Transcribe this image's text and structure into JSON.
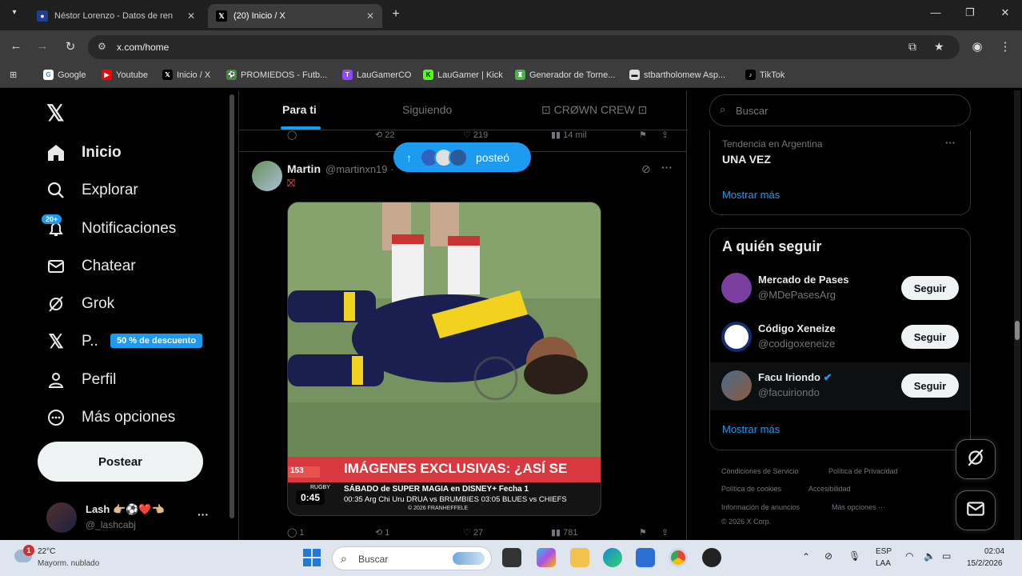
{
  "browser": {
    "tabs": [
      {
        "title": "Néstor Lorenzo - Datos de ren",
        "favicon": "afa-icon"
      },
      {
        "title": "(20) Inicio / X",
        "favicon": "x-icon"
      }
    ],
    "url": "x.com/home",
    "bookmarks": [
      {
        "label": "Google",
        "icon": "google-icon",
        "color": "#4285f4"
      },
      {
        "label": "Youtube",
        "icon": "youtube-icon",
        "color": "#ff0000"
      },
      {
        "label": "Inicio / X",
        "icon": "x-icon",
        "color": "#000000"
      },
      {
        "label": "PROMIEDOS - Futb...",
        "icon": "promiedos-icon",
        "color": "#3a8f3a"
      },
      {
        "label": "LauGamerCO",
        "icon": "twitch-icon",
        "color": "#9146ff"
      },
      {
        "label": "LauGamer | Kick",
        "icon": "kick-icon",
        "color": "#53fc18"
      },
      {
        "label": "Generador de Torne...",
        "icon": "trophy-icon",
        "color": "#4caf50"
      },
      {
        "label": "stbartholomew Asp...",
        "icon": "bookmark-icon",
        "color": "#ffffff"
      },
      {
        "label": "TikTok",
        "icon": "tiktok-icon",
        "color": "#000000"
      }
    ]
  },
  "nav": {
    "items": [
      {
        "label": "Inicio",
        "icon": "home-icon",
        "active": true
      },
      {
        "label": "Explorar",
        "icon": "search-icon"
      },
      {
        "label": "Notificaciones",
        "icon": "bell-icon"
      },
      {
        "label": "Chatear",
        "icon": "mail-icon"
      },
      {
        "label": "Grok",
        "icon": "grok-icon"
      },
      {
        "label": "P..",
        "icon": "x-premium-icon"
      },
      {
        "label": "Perfil",
        "icon": "person-icon"
      },
      {
        "label": "Más opciones",
        "icon": "more-circle-icon"
      }
    ],
    "notif_badge": "20+",
    "promo_badge": "50 % de descuento",
    "post_button": "Postear",
    "account": {
      "name": "Lash 👉🏼⚽❤️👈🏼",
      "handle": "@_lashcabj",
      "more": "···"
    }
  },
  "feed": {
    "tabs": [
      {
        "label": "Para ti",
        "active": true
      },
      {
        "label": "Siguiendo"
      },
      {
        "label": "⊡ CRØWN CREW ⊡"
      }
    ],
    "prev_actions": {
      "replies": "",
      "reposts": "22",
      "likes": "219",
      "views": "14 mil"
    },
    "posted_pill": "posteó",
    "tweet": {
      "name": "Martin",
      "handle": "@martinxn19 ·",
      "media": {
        "banner": "IMÁGENES EXCLUSIVAS: ¿ASÍ SE",
        "score": "153",
        "ticker_line1": "SÁBADO de SUPER MAGIA en DISNEY+   Fecha 1",
        "ticker_line2": "00:35 Arg  Chi  Uru  DRUA vs BRUMBIES     03:05 BLUES vs CHIEFS",
        "ticker_line3": "© 2026 FRANHEFFELE",
        "ticker_tag": "RUGBY",
        "duration": "0:45"
      },
      "actions": {
        "replies": "1",
        "reposts": "1",
        "likes": "27",
        "views": "781"
      }
    }
  },
  "sidebar": {
    "search_placeholder": "Buscar",
    "trend": {
      "context": "Tendencia en Argentina",
      "title": "UNA VEZ",
      "more": "Mostrar más"
    },
    "who_to_follow": {
      "title": "A quién seguir",
      "users": [
        {
          "name": "Mercado de Pases",
          "handle": "@MDePasesArg",
          "button": "Seguir",
          "verified": false,
          "color": "#7b3fa0"
        },
        {
          "name": "Código Xeneize",
          "handle": "@codigoxeneize",
          "button": "Seguir",
          "verified": false,
          "color": "#ffffff"
        },
        {
          "name": "Facu Iriondo",
          "handle": "@facuiriondo",
          "button": "Seguir",
          "verified": true,
          "color": "#4a6b8a"
        }
      ],
      "more": "Mostrar más"
    },
    "footer": {
      "links": [
        "Condiciones de Servicio",
        "Política de Privacidad",
        "Política de cookies",
        "Accesibilidad",
        "Información de anuncios",
        "Más opciones ···"
      ],
      "copyright": "© 2026 X Corp."
    }
  },
  "taskbar": {
    "weather": {
      "temp": "22°C",
      "desc": "Mayorm. nublado",
      "alert": "1"
    },
    "search_placeholder": "Buscar",
    "lang": {
      "top": "ESP",
      "bottom": "LAA"
    },
    "time": "02:04",
    "date": "15/2/2026"
  },
  "colors": {
    "accent": "#1d9bf0",
    "bg": "#000000",
    "text": "#e7e9ea",
    "muted": "#71767b"
  }
}
